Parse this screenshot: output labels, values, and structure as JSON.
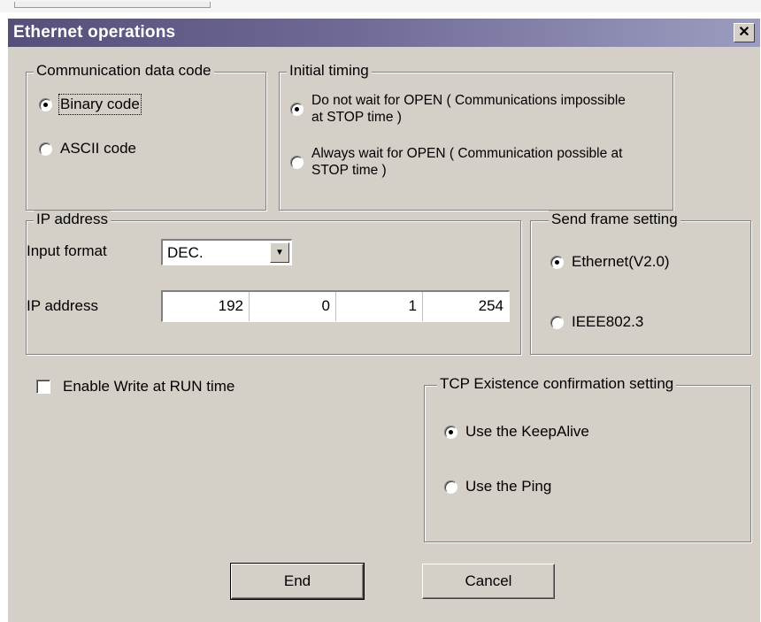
{
  "window": {
    "title": "Ethernet operations",
    "close_glyph": "✕"
  },
  "comm_code": {
    "legend": "Communication data code",
    "options": [
      {
        "label": "Binary code",
        "selected": true
      },
      {
        "label": "ASCII code",
        "selected": false
      }
    ]
  },
  "initial_timing": {
    "legend": "Initial timing",
    "options": [
      {
        "label": "Do not wait for OPEN ( Communications impossible at STOP time )",
        "selected": true
      },
      {
        "label": "Always wait for OPEN ( Communication possible at STOP time )",
        "selected": false
      }
    ]
  },
  "ip": {
    "legend": "IP address",
    "input_format_label": "Input format",
    "input_format_value": "DEC.",
    "ip_label": "IP address",
    "octets": [
      "192",
      "0",
      "1",
      "254"
    ]
  },
  "send_frame": {
    "legend": "Send frame setting",
    "options": [
      {
        "label": "Ethernet(V2.0)",
        "selected": true
      },
      {
        "label": "IEEE802.3",
        "selected": false
      }
    ]
  },
  "enable_write": {
    "label": "Enable Write at RUN time",
    "checked": false
  },
  "tcp": {
    "legend": "TCP Existence confirmation setting",
    "options": [
      {
        "label": "Use the KeepAlive",
        "selected": true
      },
      {
        "label": "Use the Ping",
        "selected": false
      }
    ]
  },
  "buttons": {
    "end": "End",
    "cancel": "Cancel"
  }
}
